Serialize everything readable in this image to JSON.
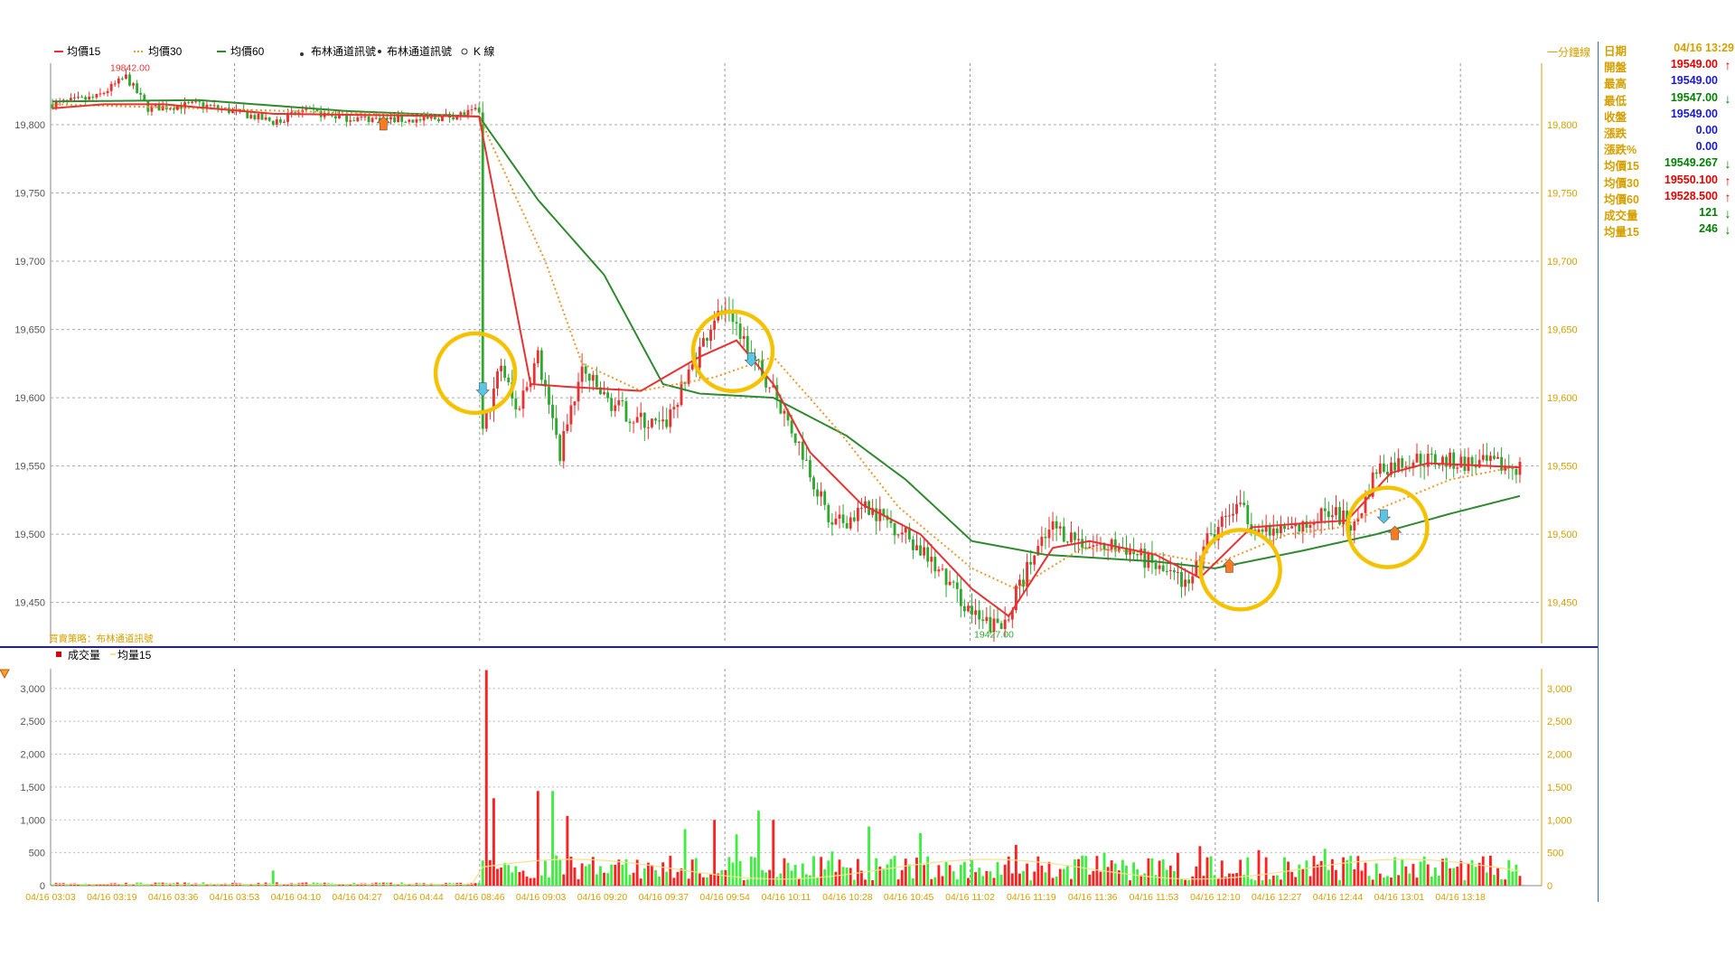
{
  "legend_top": {
    "items": [
      {
        "label": "均價15",
        "color": "#e53232",
        "style": "solid"
      },
      {
        "label": "均價30",
        "color": "#e89a2e",
        "style": "dotted"
      },
      {
        "label": "均價60",
        "color": "#2f8a2f",
        "style": "solid"
      }
    ],
    "signal_text_1": "布林通道訊號",
    "signal_text_2": "布林通道訊號",
    "kline_text": "K 線"
  },
  "chart_title_right": "一分鐘線",
  "strategy_label": "買賣策略：布林通道訊號",
  "high_label": "19842.00",
  "low_label": "19427.00",
  "legend_bottom": {
    "volume": "成交量",
    "avg_volume": "均量15"
  },
  "info_panel": {
    "date_label": "日期",
    "date_value": "04/16 13:29",
    "rows": [
      {
        "label": "開盤",
        "value": "19549.00",
        "color": "#e00000",
        "arrow": "up"
      },
      {
        "label": "最高",
        "value": "19549.00",
        "color": "#1a1acc",
        "arrow": ""
      },
      {
        "label": "最低",
        "value": "19547.00",
        "color": "#008000",
        "arrow": "down"
      },
      {
        "label": "收盤",
        "value": "19549.00",
        "color": "#1a1acc",
        "arrow": ""
      },
      {
        "label": "漲跌",
        "value": "0.00",
        "color": "#1a1acc",
        "arrow": ""
      },
      {
        "label": "漲跌%",
        "value": "0.00",
        "color": "#1a1acc",
        "arrow": ""
      },
      {
        "label": "均價15",
        "value": "19549.267",
        "color": "#008000",
        "arrow": "down"
      },
      {
        "label": "均價30",
        "value": "19550.100",
        "color": "#e00000",
        "arrow": "up"
      },
      {
        "label": "均價60",
        "value": "19528.500",
        "color": "#e00000",
        "arrow": "up"
      },
      {
        "label": "成交量",
        "value": "121",
        "color": "#008000",
        "arrow": "down"
      },
      {
        "label": "均量15",
        "value": "246",
        "color": "#008000",
        "arrow": "down"
      }
    ]
  },
  "colors": {
    "up": "#e53232",
    "down": "#2fa82f",
    "vol_up": "#ff2020",
    "vol_down": "#40ee40",
    "ma15": "#e53232",
    "ma30": "#e89a2e",
    "ma60": "#2f8a2f",
    "axis_right": "#d4a000",
    "divider": "#1a1acc",
    "circle": "#f5c200",
    "buy": "#ff7a1c",
    "sell": "#59c6e8"
  },
  "chart_data": {
    "type": "candlestick",
    "price_panel": {
      "y_ticks": [
        "19,450",
        "19,500",
        "19,550",
        "19,600",
        "19,650",
        "19,700",
        "19,750",
        "19,800"
      ],
      "y_tick_values": [
        19450,
        19500,
        19550,
        19600,
        19650,
        19700,
        19750,
        19800
      ],
      "ylim": [
        19420,
        19845
      ],
      "grid": true
    },
    "volume_panel": {
      "y_ticks": [
        "0",
        "500",
        "1,000",
        "1,500",
        "2,000",
        "2,500",
        "3,000"
      ],
      "y_tick_values": [
        0,
        500,
        1000,
        1500,
        2000,
        2500,
        3000
      ],
      "ylim": [
        0,
        3300
      ]
    },
    "x_ticks": [
      "04/16 03:03",
      "04/16 03:19",
      "04/16 03:36",
      "04/16 03:53",
      "04/16 04:10",
      "04/16 04:27",
      "04/16 04:44",
      "04/16 08:46",
      "04/16 09:03",
      "04/16 09:20",
      "04/16 09:37",
      "04/16 09:54",
      "04/16 10:11",
      "04/16 10:28",
      "04/16 10:45",
      "04/16 11:02",
      "04/16 11:19",
      "04/16 11:36",
      "04/16 11:53",
      "04/16 12:10",
      "04/16 12:27",
      "04/16 12:44",
      "04/16 13:01",
      "04/16 13:18"
    ],
    "n_bars": 400,
    "price_path": [
      [
        0,
        19815
      ],
      [
        12,
        19820
      ],
      [
        20,
        19835
      ],
      [
        26,
        19812
      ],
      [
        40,
        19815
      ],
      [
        52,
        19808
      ],
      [
        60,
        19802
      ],
      [
        68,
        19810
      ],
      [
        80,
        19805
      ],
      [
        100,
        19803
      ],
      [
        112,
        19808
      ],
      [
        116,
        19810
      ],
      [
        117,
        19575
      ],
      [
        122,
        19625
      ],
      [
        126,
        19590
      ],
      [
        132,
        19630
      ],
      [
        138,
        19560
      ],
      [
        144,
        19620
      ],
      [
        150,
        19600
      ],
      [
        158,
        19585
      ],
      [
        166,
        19578
      ],
      [
        172,
        19610
      ],
      [
        180,
        19660
      ],
      [
        184,
        19665
      ],
      [
        190,
        19630
      ],
      [
        196,
        19605
      ],
      [
        204,
        19560
      ],
      [
        212,
        19505
      ],
      [
        222,
        19520
      ],
      [
        232,
        19500
      ],
      [
        242,
        19470
      ],
      [
        252,
        19435
      ],
      [
        258,
        19432
      ],
      [
        266,
        19480
      ],
      [
        272,
        19505
      ],
      [
        282,
        19492
      ],
      [
        292,
        19490
      ],
      [
        302,
        19472
      ],
      [
        308,
        19464
      ],
      [
        314,
        19495
      ],
      [
        322,
        19520
      ],
      [
        330,
        19500
      ],
      [
        340,
        19505
      ],
      [
        346,
        19520
      ],
      [
        354,
        19505
      ],
      [
        360,
        19548
      ],
      [
        370,
        19555
      ],
      [
        386,
        19552
      ],
      [
        399,
        19549
      ]
    ],
    "ma15_path": [
      [
        0,
        19812
      ],
      [
        14,
        19815
      ],
      [
        30,
        19815
      ],
      [
        60,
        19808
      ],
      [
        116,
        19806
      ],
      [
        130,
        19610
      ],
      [
        140,
        19608
      ],
      [
        160,
        19605
      ],
      [
        176,
        19630
      ],
      [
        186,
        19642
      ],
      [
        196,
        19610
      ],
      [
        206,
        19560
      ],
      [
        220,
        19522
      ],
      [
        236,
        19500
      ],
      [
        250,
        19460
      ],
      [
        260,
        19440
      ],
      [
        272,
        19490
      ],
      [
        282,
        19495
      ],
      [
        300,
        19485
      ],
      [
        312,
        19468
      ],
      [
        326,
        19505
      ],
      [
        340,
        19508
      ],
      [
        352,
        19510
      ],
      [
        364,
        19545
      ],
      [
        374,
        19552
      ],
      [
        399,
        19549
      ]
    ],
    "ma30_path": [
      [
        0,
        19815
      ],
      [
        116,
        19806
      ],
      [
        134,
        19700
      ],
      [
        144,
        19625
      ],
      [
        160,
        19605
      ],
      [
        180,
        19615
      ],
      [
        196,
        19630
      ],
      [
        214,
        19575
      ],
      [
        230,
        19520
      ],
      [
        250,
        19475
      ],
      [
        262,
        19460
      ],
      [
        280,
        19490
      ],
      [
        300,
        19486
      ],
      [
        316,
        19478
      ],
      [
        336,
        19500
      ],
      [
        350,
        19505
      ],
      [
        362,
        19520
      ],
      [
        380,
        19540
      ],
      [
        399,
        19550
      ]
    ],
    "ma60_path": [
      [
        0,
        19817
      ],
      [
        40,
        19818
      ],
      [
        80,
        19810
      ],
      [
        116,
        19806
      ],
      [
        132,
        19745
      ],
      [
        150,
        19690
      ],
      [
        166,
        19610
      ],
      [
        176,
        19603
      ],
      [
        196,
        19600
      ],
      [
        216,
        19572
      ],
      [
        232,
        19540
      ],
      [
        250,
        19495
      ],
      [
        270,
        19485
      ],
      [
        300,
        19480
      ],
      [
        316,
        19475
      ],
      [
        340,
        19488
      ],
      [
        360,
        19500
      ],
      [
        380,
        19515
      ],
      [
        399,
        19528
      ]
    ],
    "volume_spikes": [
      [
        60,
        230
      ],
      [
        118,
        3280
      ],
      [
        120,
        1330
      ],
      [
        132,
        1440
      ],
      [
        136,
        1440
      ],
      [
        140,
        1060
      ],
      [
        172,
        860
      ],
      [
        180,
        1000
      ],
      [
        186,
        780
      ],
      [
        192,
        1140
      ],
      [
        196,
        1000
      ],
      [
        212,
        520
      ],
      [
        222,
        900
      ],
      [
        236,
        800
      ],
      [
        262,
        620
      ],
      [
        286,
        500
      ],
      [
        306,
        500
      ],
      [
        312,
        600
      ],
      [
        328,
        540
      ],
      [
        346,
        560
      ]
    ],
    "markers": [
      {
        "type": "sell",
        "x": 117,
        "y": 19605
      },
      {
        "type": "buy",
        "x": 90,
        "y": 19800
      },
      {
        "type": "sell",
        "x": 190,
        "y": 19627
      },
      {
        "type": "buy",
        "x": 320,
        "y": 19476
      },
      {
        "type": "sell",
        "x": 362,
        "y": 19512
      },
      {
        "type": "buy",
        "x": 365,
        "y": 19500
      }
    ],
    "highlight_circles": [
      {
        "x": 115,
        "y": 19618
      },
      {
        "x": 185,
        "y": 19634
      },
      {
        "x": 323,
        "y": 19474
      },
      {
        "x": 363,
        "y": 19505
      }
    ]
  }
}
